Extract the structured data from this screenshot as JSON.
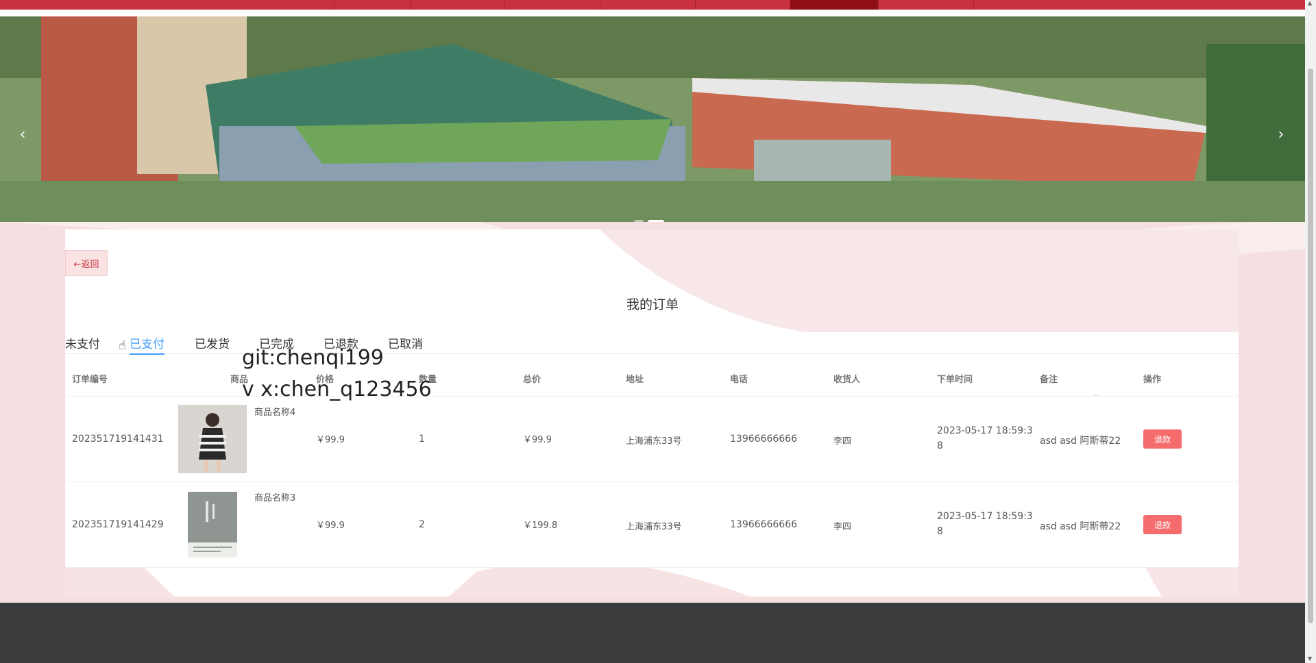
{
  "nav": {
    "segments": 9,
    "active_index": 7,
    "colors": {
      "bar": "#c8323f",
      "active": "#8f0e17"
    }
  },
  "banner": {
    "prev_icon": "‹",
    "next_icon": "›",
    "dots": [
      false,
      true
    ]
  },
  "page": {
    "back_label": "←返回",
    "title": "我的订单"
  },
  "tabs": [
    {
      "label": "未支付",
      "active": false
    },
    {
      "label": "已支付",
      "active": true
    },
    {
      "label": "已发货",
      "active": false
    },
    {
      "label": "已完成",
      "active": false
    },
    {
      "label": "已退款",
      "active": false
    },
    {
      "label": "已取消",
      "active": false
    }
  ],
  "watermark": {
    "line1": "git:chenqi199",
    "line2": "v x:chen_q123456"
  },
  "table": {
    "headers": [
      "订单编号",
      "商品",
      "价格",
      "数量",
      "总价",
      "地址",
      "电话",
      "收货人",
      "下单时间",
      "备注",
      "操作"
    ],
    "rows": [
      {
        "order_no": "202351719141431",
        "product": "商品名称4",
        "price": "￥99.9",
        "qty": "1",
        "total": "￥99.9",
        "address": "上海浦东33号",
        "phone": "13966666666",
        "receiver": "李四",
        "time_line1": "2023-05-17 18:59:3",
        "time_line2": "8",
        "remark": "asd asd 阿斯蒂22",
        "action": "退款"
      },
      {
        "order_no": "202351719141429",
        "product": "商品名称3",
        "price": "￥99.9",
        "qty": "2",
        "total": "￥199.8",
        "address": "上海浦东33号",
        "phone": "13966666666",
        "receiver": "李四",
        "time_line1": "2023-05-17 18:59:3",
        "time_line2": "8",
        "remark": "asd asd 阿斯蒂22",
        "action": "退款"
      }
    ]
  },
  "colors": {
    "accent": "#409eff",
    "danger": "#f56c6c",
    "pink_bg": "#f6dfe1",
    "footer": "#3a3c3e"
  }
}
